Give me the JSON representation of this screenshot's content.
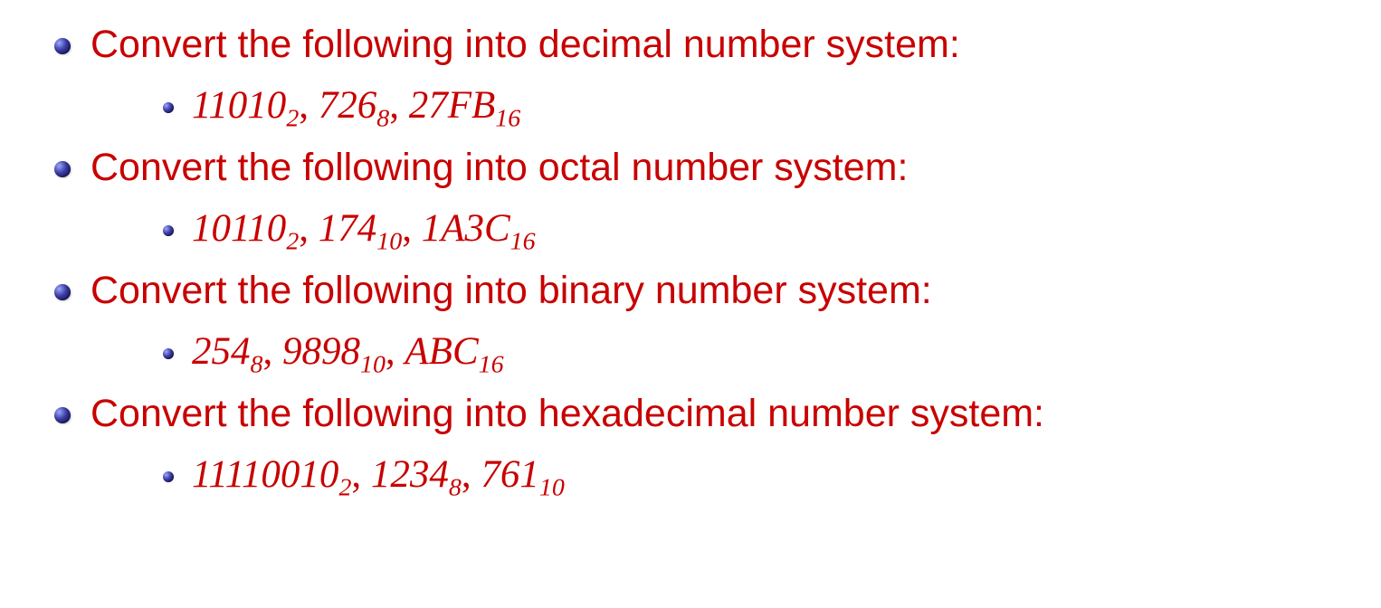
{
  "items": [
    {
      "title": "Convert the following into decimal number system:",
      "values": [
        {
          "num": "11010",
          "base": "2"
        },
        {
          "num": "726",
          "base": "8"
        },
        {
          "num": "27FB",
          "base": "16"
        }
      ]
    },
    {
      "title": "Convert the following into octal number system:",
      "values": [
        {
          "num": "10110",
          "base": "2"
        },
        {
          "num": "174",
          "base": "10"
        },
        {
          "num": "1A3C",
          "base": "16"
        }
      ]
    },
    {
      "title": "Convert the following into binary number system:",
      "values": [
        {
          "num": "254",
          "base": "8"
        },
        {
          "num": "9898",
          "base": "10"
        },
        {
          "num": "ABC",
          "base": "16"
        }
      ]
    },
    {
      "title": "Convert the following into hexadecimal number system:",
      "values": [
        {
          "num": "11110010",
          "base": "2"
        },
        {
          "num": "1234",
          "base": "8"
        },
        {
          "num": "761",
          "base": "10"
        }
      ]
    }
  ]
}
